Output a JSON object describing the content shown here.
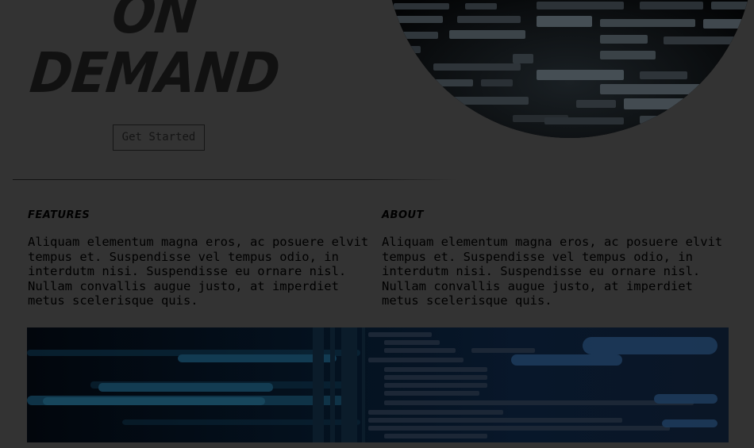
{
  "hero": {
    "title_line1": "On",
    "title_line2": "Demand",
    "cta_label": "Get Started"
  },
  "features": {
    "heading": "Features",
    "body": "Aliquam elementum magna eros, ac posuere elvit tempus et. Suspendisse vel tempus odio, in interdutm nisi. Suspendisse eu ornare nisl. Nullam convallis augue justo, at imperdiet metus scelerisque quis."
  },
  "about": {
    "heading": "About",
    "body": "Aliquam elementum magna eros, ac posuere elvit tempus et. Suspendisse vel tempus odio, in interdutm nisi. Suspendisse eu ornare nisl. Nullam convallis augue justo, at imperdiet metus scelerisque quis."
  },
  "colors": {
    "page_background": "#333333",
    "text": "#000000"
  }
}
